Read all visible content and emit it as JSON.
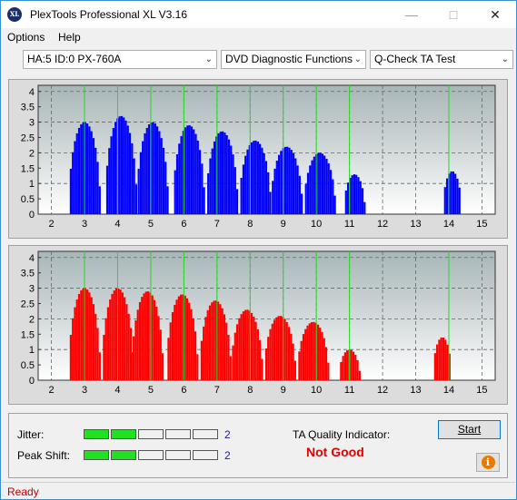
{
  "window": {
    "title": "PlexTools Professional XL V3.16",
    "icon_text": "XL"
  },
  "menu": [
    {
      "label": "Options"
    },
    {
      "label": "Help"
    }
  ],
  "toolbar": {
    "drive": "HA:5 ID:0  PX-760A",
    "function": "DVD Diagnostic Functions",
    "test": "Q-Check TA Test"
  },
  "chart_data": [
    {
      "type": "bar",
      "title": "",
      "color": "#0000ff",
      "x_ticks": [
        "2",
        "3",
        "4",
        "5",
        "6",
        "7",
        "8",
        "9",
        "10",
        "11",
        "12",
        "13",
        "14",
        "15"
      ],
      "y_ticks": [
        "0",
        "0.5",
        "1",
        "1.5",
        "2",
        "2.5",
        "3",
        "3.5",
        "4"
      ],
      "ylim": [
        0,
        4.2
      ],
      "xlim": [
        1.6,
        15.4
      ],
      "green_markers": [
        3,
        4,
        5,
        6,
        7,
        8,
        9,
        10,
        11,
        14
      ],
      "grid": true,
      "peaks": [
        {
          "center": 3.0,
          "height": 3.0
        },
        {
          "center": 4.1,
          "height": 3.2
        },
        {
          "center": 5.05,
          "height": 3.0
        },
        {
          "center": 6.15,
          "height": 2.9
        },
        {
          "center": 7.15,
          "height": 2.7
        },
        {
          "center": 8.15,
          "height": 2.4
        },
        {
          "center": 9.1,
          "height": 2.2
        },
        {
          "center": 10.1,
          "height": 2.0
        },
        {
          "center": 11.15,
          "height": 1.3
        },
        {
          "center": 14.1,
          "height": 1.4
        }
      ]
    },
    {
      "type": "bar",
      "title": "",
      "color": "#ff0000",
      "x_ticks": [
        "2",
        "3",
        "4",
        "5",
        "6",
        "7",
        "8",
        "9",
        "10",
        "11",
        "12",
        "13",
        "14",
        "15"
      ],
      "y_ticks": [
        "0",
        "0.5",
        "1",
        "1.5",
        "2",
        "2.5",
        "3",
        "3.5",
        "4"
      ],
      "ylim": [
        0,
        4.2
      ],
      "xlim": [
        1.6,
        15.4
      ],
      "green_markers": [
        3,
        4,
        5,
        6,
        7,
        8,
        9,
        10,
        11,
        14
      ],
      "grid": true,
      "peaks": [
        {
          "center": 3.0,
          "height": 3.0
        },
        {
          "center": 4.0,
          "height": 3.0
        },
        {
          "center": 4.9,
          "height": 2.9
        },
        {
          "center": 5.95,
          "height": 2.8
        },
        {
          "center": 6.95,
          "height": 2.6
        },
        {
          "center": 7.9,
          "height": 2.3
        },
        {
          "center": 8.9,
          "height": 2.1
        },
        {
          "center": 9.9,
          "height": 1.9
        },
        {
          "center": 11.0,
          "height": 1.0
        },
        {
          "center": 13.8,
          "height": 1.4
        }
      ]
    }
  ],
  "metrics": {
    "jitter": {
      "label": "Jitter:",
      "value": "2",
      "level": 2,
      "segments": 5
    },
    "peak_shift": {
      "label": "Peak Shift:",
      "value": "2",
      "level": 2,
      "segments": 5
    }
  },
  "ta_quality": {
    "label": "TA Quality Indicator:",
    "value": "Not Good"
  },
  "buttons": {
    "start": "Start",
    "info_icon": "info-icon"
  },
  "status": {
    "text": "Ready"
  }
}
